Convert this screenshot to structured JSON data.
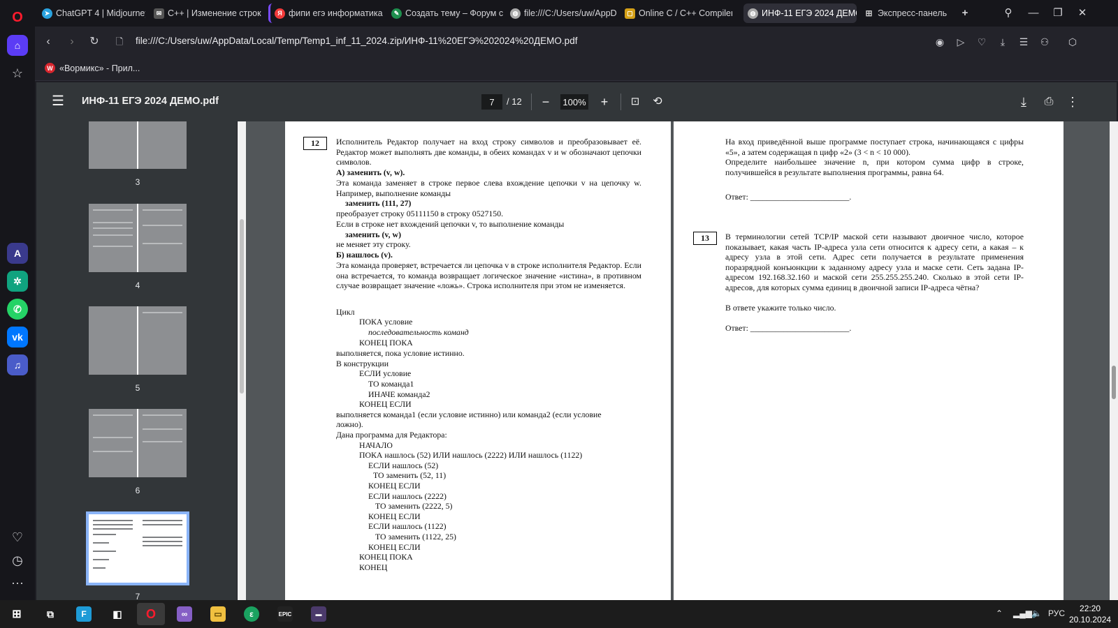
{
  "browser": {
    "tabs": [
      {
        "label": "ChatGPT 4 | Midjourney |",
        "icon": "telegram-icon",
        "color": "#2aa3e0"
      },
      {
        "label": "C++ | Изменение строки",
        "icon": "mail-icon",
        "color": "#555"
      },
      {
        "label": "фипи егэ информатика",
        "icon": "yandex-icon",
        "color": "#f23a3a"
      },
      {
        "label": "Создать тему – Форум сс",
        "icon": "forum-icon",
        "color": "#1e8f4e"
      },
      {
        "label": "file:///C:/Users/uw/AppD",
        "icon": "globe-icon",
        "color": "#aaa"
      },
      {
        "label": "Online C / C++ Compiler",
        "icon": "compiler-icon",
        "color": "#d4a017"
      },
      {
        "label": "ИНФ-11 ЕГЭ 2024 ДЕМО.",
        "icon": "globe-icon",
        "color": "#aaa"
      },
      {
        "label": "Экспресс-панель",
        "icon": "grid-icon",
        "color": "#888"
      }
    ],
    "url": "file:///C:/Users/uw/AppData/Local/Temp/Temp1_inf_11_2024.zip/ИНФ-11%20ЕГЭ%202024%20ДЕМО.pdf",
    "bookmark": "«Вормикс» - Прил..."
  },
  "pdf": {
    "title": "ИНФ-11 ЕГЭ 2024 ДЕМО.pdf",
    "current_page": "7",
    "total_pages": "/ 12",
    "zoom": "100%",
    "thumbnails": [
      {
        "label": "3"
      },
      {
        "label": "4"
      },
      {
        "label": "5"
      },
      {
        "label": "6"
      },
      {
        "label": "7",
        "current": true
      }
    ]
  },
  "page_left": {
    "task_number": "12",
    "intro": "Исполнитель Редактор получает на вход строку символов и преобразовывает её. Редактор может выполнять две команды, в обеих командах v и w обозначают цепочки символов.",
    "cmd_a": "А) заменить (v, w).",
    "cmd_a_desc": "Эта команда заменяет в строке первое слева вхождение цепочки v на цепочку w. Например, выполнение команды",
    "example_cmd": "заменить (111, 27)",
    "example_result": "преобразует строку 05111150 в строку 0527150.",
    "no_match": "Если в строке нет вхождений цепочки v, то выполнение команды",
    "cmd_vw": "заменить (v, w)",
    "unchanged": "не меняет эту строку.",
    "cmd_b": "Б) нашлось (v).",
    "cmd_b_desc": "Эта команда проверяет, встречается ли цепочка v в строке исполнителя Редактор. Если она встречается, то команда возвращает логическое значение «истина», в противном случае возвращает значение «ложь». Строка исполнителя при этом не изменяется.",
    "loop": "Цикл",
    "while_cond": "ПОКА условие",
    "cmd_seq": "последовательность команд",
    "end_while": "КОНЕЦ ПОКА",
    "loop_desc": "выполняется, пока условие истинно.",
    "in_construct": "В конструкции",
    "if_cond": "ЕСЛИ условие",
    "then_cmd": "ТО команда1",
    "else_cmd": "ИНАЧЕ команда2",
    "end_if": "КОНЕЦ ЕСЛИ",
    "if_desc_1": "выполняется команда1 (если условие истинно) или команда2 (если условие",
    "if_desc_2": "ложно).",
    "program_intro": "Дана программа для Редактора:",
    "program": [
      "НАЧАЛО",
      "ПОКА нашлось (52) ИЛИ нашлось (2222) ИЛИ нашлось (1122)",
      "ЕСЛИ нашлось (52)",
      "ТО заменить (52, 11)",
      "КОНЕЦ ЕСЛИ",
      "ЕСЛИ нашлось (2222)",
      "ТО заменить (2222, 5)",
      "КОНЕЦ ЕСЛИ",
      "ЕСЛИ нашлось (1122)",
      "ТО заменить (1122, 25)",
      "КОНЕЦ ЕСЛИ",
      "КОНЕЦ ПОКА",
      "КОНЕЦ"
    ]
  },
  "page_right": {
    "p1": "На вход приведённой выше программе поступает строка, начинающаяся с цифры «5», а затем содержащая n цифр «2» (3 < n < 10 000).",
    "p2": "Определите наибольшее значение n, при котором сумма цифр в строке, получившейся в результате выполнения программы, равна 64.",
    "answer_label": "Ответ: ________________________.",
    "task_number": "13",
    "task13": "В терминологии сетей TCP/IP маской сети называют двоичное число, которое показывает, какая часть IP-адреса узла сети относится к адресу сети, а какая – к адресу узла в этой сети. Адрес сети получается в результате применения поразрядной конъюнкции к заданному адресу узла и маске сети. Сеть задана IP-адресом 192.168.32.160 и маской сети 255.255.255.240. Сколько в этой сети IP-адресов, для которых сумма единиц в двоичной записи IP-адреса чётна?",
    "task13_note": "В ответе укажите только число.",
    "answer_label_2": "Ответ: ________________________."
  },
  "taskbar": {
    "lang": "РУС",
    "time": "22:20",
    "date": "20.10.2024"
  }
}
